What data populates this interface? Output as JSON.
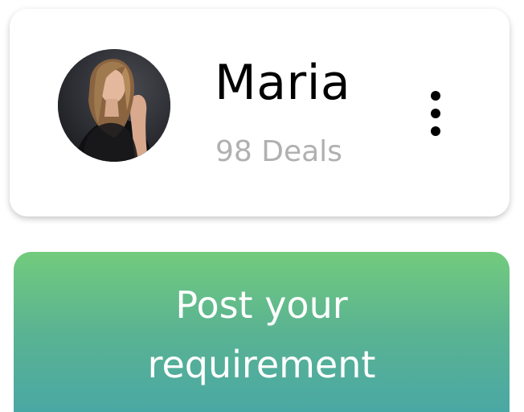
{
  "profile": {
    "name": "Maria",
    "deals": "98 Deals",
    "avatar_icon": "user-photo",
    "more_icon": "more-vertical-icon"
  },
  "cta": {
    "label": "Post your requirement",
    "gradient_top": "#72cb7d",
    "gradient_bottom": "#4aa8a4"
  }
}
